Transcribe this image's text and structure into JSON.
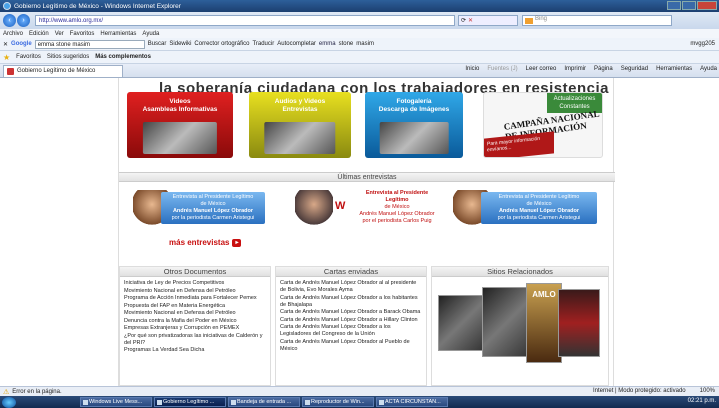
{
  "window": {
    "title": "Gobierno Legítimo de México - Windows Internet Explorer"
  },
  "address": {
    "url": "http://www.amlo.org.mx/",
    "search_engine": "Bing"
  },
  "menu": [
    "Archivo",
    "Edición",
    "Ver",
    "Favoritos",
    "Herramientas",
    "Ayuda"
  ],
  "google_bar": {
    "label": "Google",
    "query": "emma stone masim",
    "buscar": "Buscar",
    "sidewiki": "Sidewiki",
    "corrector": "Corrector ortográfico",
    "traducir": "Traducir",
    "autocompletar": "Autocompletar",
    "terms": [
      "emma",
      "stone",
      "masim"
    ],
    "account": "mvgg205"
  },
  "favorites": {
    "label": "Favoritos",
    "items": [
      "Sitios sugeridos",
      "Más complementos"
    ]
  },
  "tab": {
    "title": "Gobierno Legítimo de México"
  },
  "command_bar": [
    "Inicio",
    "Fuentes (J)",
    "Leer correo",
    "Imprimir",
    "Página",
    "Seguridad",
    "Herramientas",
    "Ayuda"
  ],
  "page": {
    "headline": "la soberanía ciudadana con los trabajadores en resistencia",
    "banners": [
      {
        "title": "Videos\nAsambleas Informativas"
      },
      {
        "title": "Audios y Videos\nEntrevistas"
      },
      {
        "title": "Fotogalería\nDescarga de Imágenes"
      }
    ],
    "campaign": {
      "green": "Actualizaciones Constantes",
      "title": "CAMPAÑA NACIONAL DE INFORMACIÓN",
      "red": "Para mayor información envíanos..."
    },
    "ultimas": "Últimas entrevistas",
    "interviews": [
      {
        "line1": "Entrevista al Presidente Legítimo",
        "line2": "de México",
        "line3": "Andrés Manuel López Obrador",
        "line4": "por la periodista Carmen Aristegui"
      },
      {
        "logo": "W",
        "line1": "Entrevista al Presidente Legítimo",
        "line2": "de México",
        "line3": "Andrés Manuel López Obrador",
        "line4": "por el periodista Carlos Puig"
      },
      {
        "line1": "Entrevista al Presidente Legítimo",
        "line2": "de México",
        "line3": "Andrés Manuel López Obrador",
        "line4": "por la periodista Carmen Aristegui"
      }
    ],
    "mas_entrevistas": "más entrevistas",
    "otros": {
      "title": "Otros Documentos",
      "items": [
        "Iniciativa de Ley de Precios Competitivos",
        "Movimiento Nacional en Defensa del Petróleo",
        "Programa de Acción Inmediata para Fortalecer Pemex",
        "Propuesta del FAP en Materia Energética",
        "Movimiento Nacional en Defensa del Petróleo",
        "Denuncia contra la Mafia del Poder en México",
        "Empresas Extranjeras y Corrupción en PEMEX",
        "¿Por qué son privatizadoras las iniciativas de Calderón y del PRI?",
        "Programas La Verdad Sea Dicha"
      ]
    },
    "cartas": {
      "title": "Cartas enviadas",
      "items": [
        "Carta de Andrés Manuel López Obrador al al presidente de Bolivia, Evo Morales Ayma",
        "Carta de Andrés Manuel López Obrador a los habitantes de Bhajalapa",
        "Carta de Andrés Manuel López Obrador a Barack Obama",
        "Carta de Andrés Manuel López Obrador a Hillary Clinton",
        "Carta de Andrés Manuel López Obrador a los Legisladores del Congreso de la Unión",
        "Carta de Andrés Manuel López Obrador al Pueblo de México"
      ]
    },
    "sitios": {
      "title": "Sitios Relacionados",
      "amlo": "AMLO"
    }
  },
  "status": {
    "text": "Error en la página.",
    "zone": "Internet | Modo protegido: activado",
    "zoom": "100%"
  },
  "taskbar": {
    "items": [
      "Windows Live Mess...",
      "Gobierno Legítimo ...",
      "Bandeja de entrada ...",
      "Reproductor de Win...",
      "ACTA CIRCUNSTAN..."
    ],
    "clock": "02:21 p.m."
  },
  "colors": {
    "accent_red": "#c81010",
    "ie_blue": "#1c3f70"
  }
}
